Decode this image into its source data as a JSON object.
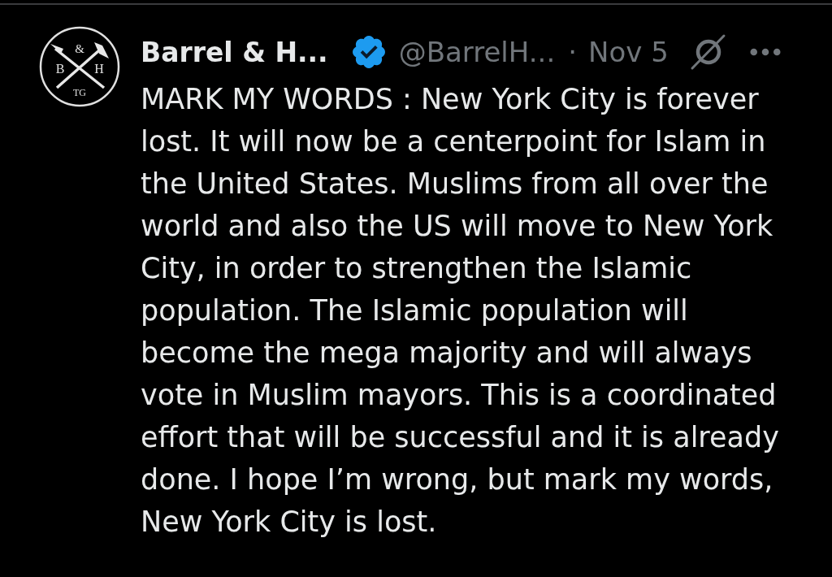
{
  "tweet": {
    "avatar": {
      "monogram": [
        "&",
        "B",
        "H",
        "TG"
      ]
    },
    "author": {
      "name": "Barrel & H...",
      "verified": true,
      "handle": "@BarrelH...",
      "separator": "·",
      "date": "Nov 5"
    },
    "text": "MARK MY WORDS : New York City is forever lost. It will now be a centerpoint for Islam in the United States. Muslims from all over the world and also the US will move to New York City, in order to strengthen the Islamic population. The Islamic population will become the mega majority and will always vote in Muslim mayors. This is a coordinated effort that will be successful and it is already done. I hope I’m wrong, but mark my words, New York City is lost."
  }
}
